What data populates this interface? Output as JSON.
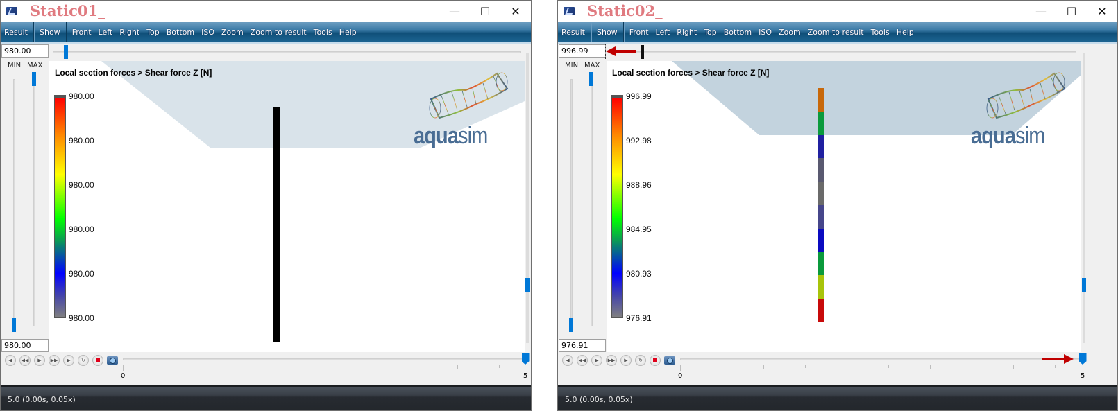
{
  "windows": [
    {
      "title": "Static01_",
      "window_controls": {
        "minimize": "—",
        "maximize": "☐",
        "close": "✕"
      },
      "menu": [
        "Result",
        "Show",
        "Front",
        "Left",
        "Right",
        "Top",
        "Bottom",
        "ISO",
        "Zoom",
        "Zoom to result",
        "Tools",
        "Help"
      ],
      "max_value": "980.00",
      "min_value": "980.00",
      "min_label": "MIN",
      "max_label": "MAX",
      "viewport_title": "Local section forces > Shear force Z [N]",
      "legend_labels": [
        "980.00",
        "980.00",
        "980.00",
        "980.00",
        "980.00",
        "980.00"
      ],
      "logo": {
        "bold": "aqua",
        "light": "sim"
      },
      "element_colors": [
        "#000000"
      ],
      "timeline": {
        "start_label": "0",
        "end_label": "5",
        "position_fraction": 1.0
      },
      "status": "5.0 (0.00s, 0.05x)",
      "icons": [
        "first-frame-icon",
        "prev-frame-icon",
        "play-icon",
        "next-frame-icon",
        "last-frame-icon",
        "loop-icon",
        "record-icon",
        "camera-icon"
      ]
    },
    {
      "title": "Static02_",
      "window_controls": {
        "minimize": "—",
        "maximize": "☐",
        "close": "✕"
      },
      "menu": [
        "Result",
        "Show",
        "Front",
        "Left",
        "Right",
        "Top",
        "Bottom",
        "ISO",
        "Zoom",
        "Zoom to result",
        "Tools",
        "Help"
      ],
      "max_value": "996.99",
      "min_value": "976.91",
      "min_label": "MIN",
      "max_label": "MAX",
      "viewport_title": "Local section forces > Shear force Z [N]",
      "legend_labels": [
        "996.99",
        "992.98",
        "988.96",
        "984.95",
        "980.93",
        "976.91"
      ],
      "logo": {
        "bold": "aqua",
        "light": "sim"
      },
      "element_colors": [
        "#c8680a",
        "#0a9a3c",
        "#2020a0",
        "#595970",
        "#6a6a6a",
        "#46468a",
        "#0a0ac0",
        "#0a9a3c",
        "#a8c40a",
        "#c80a0a"
      ],
      "timeline": {
        "start_label": "0",
        "end_label": "5",
        "position_fraction": 1.0
      },
      "status": "5.0 (0.00s, 0.05x)",
      "icons": [
        "first-frame-icon",
        "prev-frame-icon",
        "play-icon",
        "next-frame-icon",
        "last-frame-icon",
        "loop-icon",
        "record-icon",
        "camera-icon"
      ]
    }
  ]
}
